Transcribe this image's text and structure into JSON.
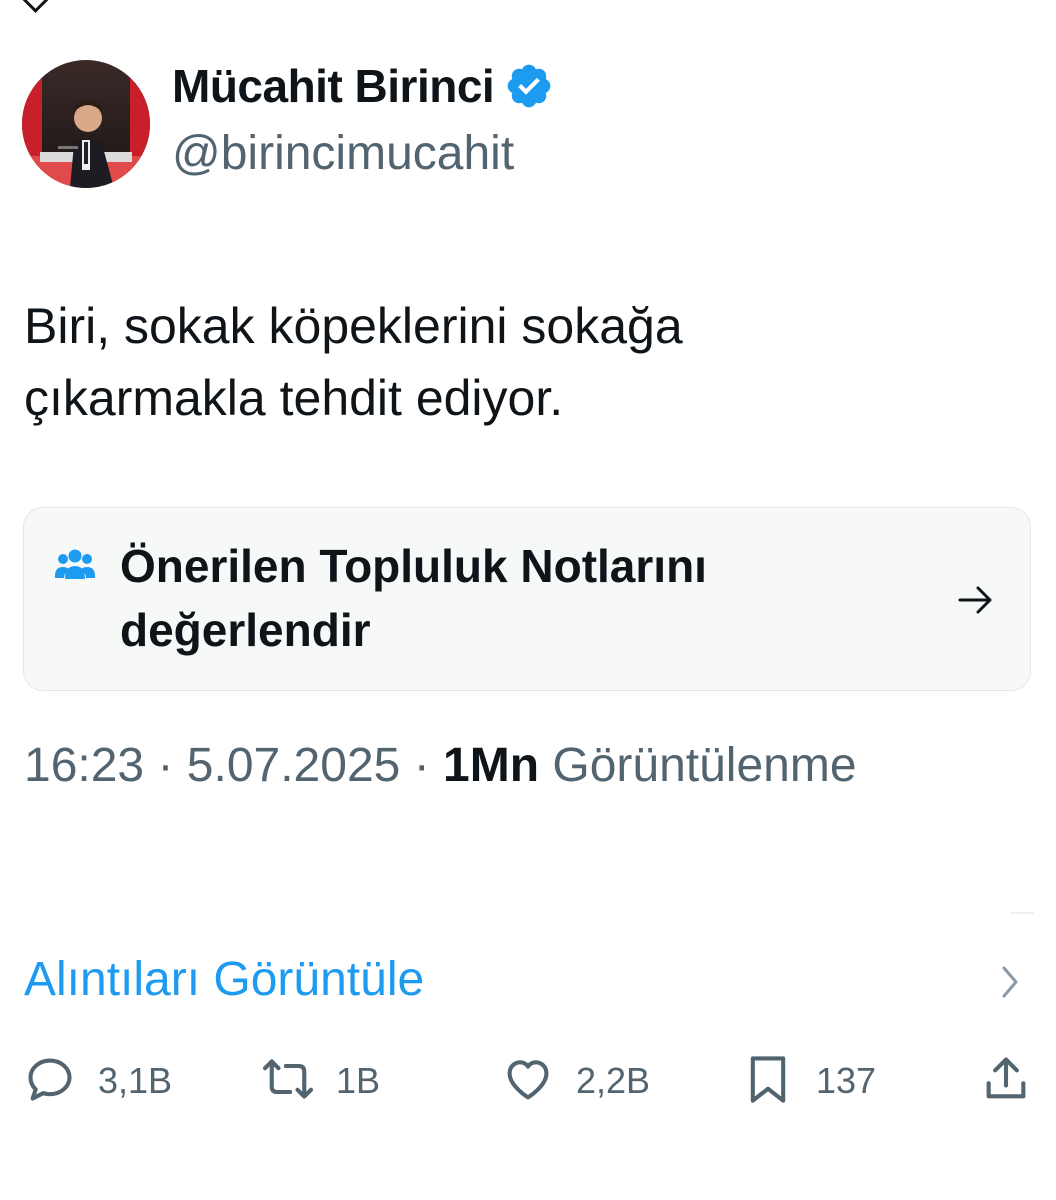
{
  "author": {
    "name": "Mücahit Birinci",
    "handle": "@birincimucahit",
    "verified": true
  },
  "tweet": {
    "text_line1": "Biri, sokak köpeklerini sokağa",
    "text_line2": "çıkarmakla tehdit ediyor."
  },
  "community_notes": {
    "title_line1": "Önerilen Topluluk Notlarını",
    "title_line2": "değerlendir",
    "icon": "people-icon"
  },
  "meta": {
    "time": "16:23",
    "separator": "·",
    "date": "5.07.2025",
    "views_count": "1Mn",
    "views_label": "Görüntülenme"
  },
  "quotes": {
    "label": "Alıntıları Görüntüle"
  },
  "actions": {
    "replies": "3,1B",
    "reposts": "1B",
    "likes": "2,2B",
    "bookmarks": "137"
  },
  "colors": {
    "accent": "#1d9bf0",
    "text": "#0f1419",
    "secondary": "#536471",
    "card_bg": "#f7f9f9"
  }
}
